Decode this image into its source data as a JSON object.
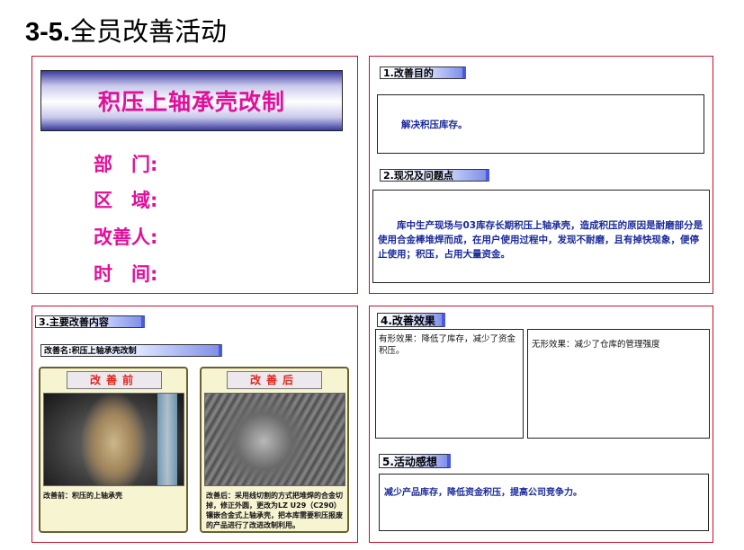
{
  "page_title": {
    "number": "3-5.",
    "text": "全员改善活动"
  },
  "cover": {
    "banner": "积压上轴承壳改制",
    "fields": [
      "部　门:",
      "区　域:",
      "改善人:",
      "时　间:"
    ]
  },
  "purpose": {
    "tag": "1.改善目的",
    "text": "解决积压库存。"
  },
  "status": {
    "tag": "2.现况及问题点",
    "text": "　　库中生产现场与03库存长期积压上轴承壳，造成积压的原因是耐磨部分是使用合金棒堆焊而成，在用户使用过程中，发现不耐磨，且有掉快现象，便停止使用；积压，占用大量资金。"
  },
  "content": {
    "tag": "3.主要改善内容",
    "name_tag": "改善名:积压上轴承壳改制",
    "before": {
      "label": "改善前",
      "caption": "改善前：积压的上轴承壳"
    },
    "after": {
      "label": "改善后",
      "caption": "改善后：采用线切割的方式把堆焊的合金切掉，修正外圆，更改为LZ U29（C290）镶嵌合金式上轴承壳，把本库需要积压报废的产品进行了改进改制利用。"
    }
  },
  "effect": {
    "tag": "4.改善效果",
    "tangible": "有形效果：降低了库存，减少了资金积压。",
    "intangible": "无形效果：减少了仓库的管理强度"
  },
  "feeling": {
    "tag": "5.活动感想",
    "text": "减少产品库存，降低资金积压，提高公司竞争力。"
  }
}
